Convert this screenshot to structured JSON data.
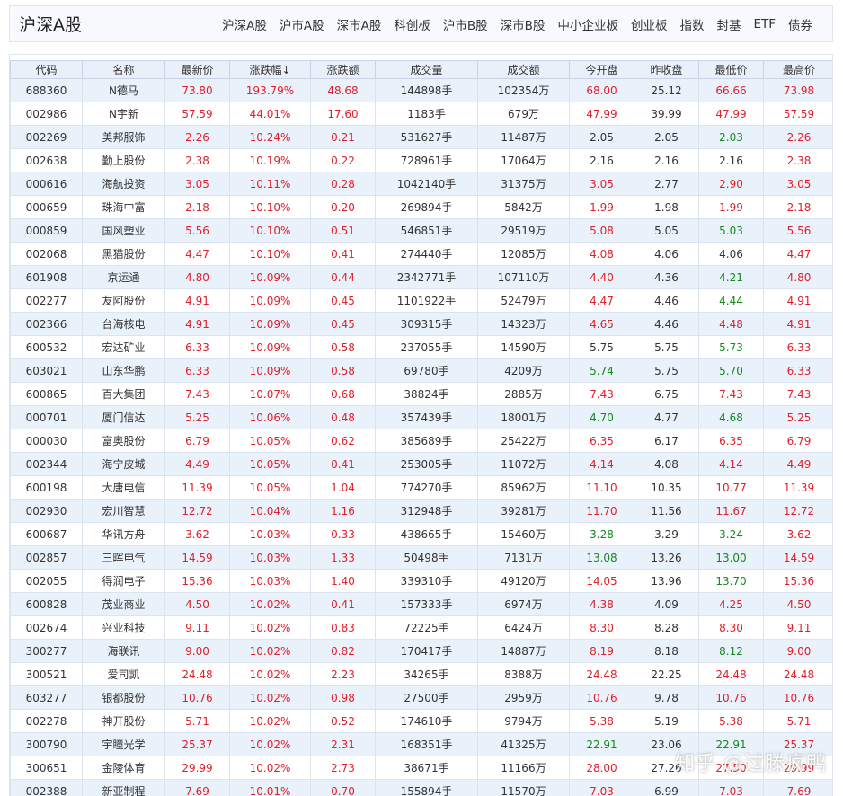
{
  "header": {
    "title": "沪深A股",
    "nav": [
      "沪深A股",
      "沪市A股",
      "深市A股",
      "科创板",
      "沪市B股",
      "深市B股",
      "中小企业板",
      "创业板",
      "指数",
      "封基",
      "ETF",
      "债券"
    ]
  },
  "table": {
    "columns": [
      "代码",
      "名称",
      "最新价",
      "涨跌幅↓",
      "涨跌额",
      "成交量",
      "成交额",
      "今开盘",
      "昨收盘",
      "最低价",
      "最高价"
    ],
    "rows": [
      [
        "688360",
        "N德马",
        "73.80",
        "193.79%",
        "48.68",
        "144898手",
        "102354万",
        "68.00",
        "25.12",
        "66.66",
        "73.98"
      ],
      [
        "002986",
        "N宇新",
        "57.59",
        "44.01%",
        "17.60",
        "1183手",
        "679万",
        "47.99",
        "39.99",
        "47.99",
        "57.59"
      ],
      [
        "002269",
        "美邦服饰",
        "2.26",
        "10.24%",
        "0.21",
        "531627手",
        "11487万",
        "2.05",
        "2.05",
        "2.03",
        "2.26"
      ],
      [
        "002638",
        "勤上股份",
        "2.38",
        "10.19%",
        "0.22",
        "728961手",
        "17064万",
        "2.16",
        "2.16",
        "2.16",
        "2.38"
      ],
      [
        "000616",
        "海航投资",
        "3.05",
        "10.11%",
        "0.28",
        "1042140手",
        "31375万",
        "3.05",
        "2.77",
        "2.90",
        "3.05"
      ],
      [
        "000659",
        "珠海中富",
        "2.18",
        "10.10%",
        "0.20",
        "269894手",
        "5842万",
        "1.99",
        "1.98",
        "1.99",
        "2.18"
      ],
      [
        "000859",
        "国风塑业",
        "5.56",
        "10.10%",
        "0.51",
        "546851手",
        "29519万",
        "5.08",
        "5.05",
        "5.03",
        "5.56"
      ],
      [
        "002068",
        "黑猫股份",
        "4.47",
        "10.10%",
        "0.41",
        "274440手",
        "12085万",
        "4.08",
        "4.06",
        "4.06",
        "4.47"
      ],
      [
        "601908",
        "京运通",
        "4.80",
        "10.09%",
        "0.44",
        "2342771手",
        "107110万",
        "4.40",
        "4.36",
        "4.21",
        "4.80"
      ],
      [
        "002277",
        "友阿股份",
        "4.91",
        "10.09%",
        "0.45",
        "1101922手",
        "52479万",
        "4.47",
        "4.46",
        "4.44",
        "4.91"
      ],
      [
        "002366",
        "台海核电",
        "4.91",
        "10.09%",
        "0.45",
        "309315手",
        "14323万",
        "4.65",
        "4.46",
        "4.48",
        "4.91"
      ],
      [
        "600532",
        "宏达矿业",
        "6.33",
        "10.09%",
        "0.58",
        "237055手",
        "14590万",
        "5.75",
        "5.75",
        "5.73",
        "6.33"
      ],
      [
        "603021",
        "山东华鹏",
        "6.33",
        "10.09%",
        "0.58",
        "69780手",
        "4209万",
        "5.74",
        "5.75",
        "5.70",
        "6.33"
      ],
      [
        "600865",
        "百大集团",
        "7.43",
        "10.07%",
        "0.68",
        "38824手",
        "2885万",
        "7.43",
        "6.75",
        "7.43",
        "7.43"
      ],
      [
        "000701",
        "厦门信达",
        "5.25",
        "10.06%",
        "0.48",
        "357439手",
        "18001万",
        "4.70",
        "4.77",
        "4.68",
        "5.25"
      ],
      [
        "000030",
        "富奥股份",
        "6.79",
        "10.05%",
        "0.62",
        "385689手",
        "25422万",
        "6.35",
        "6.17",
        "6.35",
        "6.79"
      ],
      [
        "002344",
        "海宁皮城",
        "4.49",
        "10.05%",
        "0.41",
        "253005手",
        "11072万",
        "4.14",
        "4.08",
        "4.14",
        "4.49"
      ],
      [
        "600198",
        "大唐电信",
        "11.39",
        "10.05%",
        "1.04",
        "774270手",
        "85962万",
        "11.10",
        "10.35",
        "10.77",
        "11.39"
      ],
      [
        "002930",
        "宏川智慧",
        "12.72",
        "10.04%",
        "1.16",
        "312948手",
        "39281万",
        "11.70",
        "11.56",
        "11.67",
        "12.72"
      ],
      [
        "600687",
        "华讯方舟",
        "3.62",
        "10.03%",
        "0.33",
        "438665手",
        "15460万",
        "3.28",
        "3.29",
        "3.24",
        "3.62"
      ],
      [
        "002857",
        "三晖电气",
        "14.59",
        "10.03%",
        "1.33",
        "50498手",
        "7131万",
        "13.08",
        "13.26",
        "13.00",
        "14.59"
      ],
      [
        "002055",
        "得润电子",
        "15.36",
        "10.03%",
        "1.40",
        "339310手",
        "49120万",
        "14.05",
        "13.96",
        "13.70",
        "15.36"
      ],
      [
        "600828",
        "茂业商业",
        "4.50",
        "10.02%",
        "0.41",
        "157333手",
        "6974万",
        "4.38",
        "4.09",
        "4.25",
        "4.50"
      ],
      [
        "002674",
        "兴业科技",
        "9.11",
        "10.02%",
        "0.83",
        "72225手",
        "6424万",
        "8.30",
        "8.28",
        "8.30",
        "9.11"
      ],
      [
        "300277",
        "海联讯",
        "9.00",
        "10.02%",
        "0.82",
        "170417手",
        "14887万",
        "8.19",
        "8.18",
        "8.12",
        "9.00"
      ],
      [
        "300521",
        "爱司凯",
        "24.48",
        "10.02%",
        "2.23",
        "34265手",
        "8388万",
        "24.48",
        "22.25",
        "24.48",
        "24.48"
      ],
      [
        "603277",
        "银都股份",
        "10.76",
        "10.02%",
        "0.98",
        "27500手",
        "2959万",
        "10.76",
        "9.78",
        "10.76",
        "10.76"
      ],
      [
        "002278",
        "神开股份",
        "5.71",
        "10.02%",
        "0.52",
        "174610手",
        "9794万",
        "5.38",
        "5.19",
        "5.38",
        "5.71"
      ],
      [
        "300790",
        "宇瞳光学",
        "25.37",
        "10.02%",
        "2.31",
        "168351手",
        "41325万",
        "22.91",
        "23.06",
        "22.91",
        "25.37"
      ],
      [
        "300651",
        "金陵体育",
        "29.99",
        "10.02%",
        "2.73",
        "38671手",
        "11166万",
        "28.00",
        "27.26",
        "27.50",
        "29.99"
      ],
      [
        "002388",
        "新亚制程",
        "7.69",
        "10.01%",
        "0.70",
        "155894手",
        "11570万",
        "7.03",
        "6.99",
        "7.03",
        "7.69"
      ]
    ]
  },
  "colors": {
    "up": "#e0202a",
    "down": "#138a1c",
    "header_bg": "#e9f0fa",
    "row_alt": "#e9f1fb"
  },
  "watermark": "知乎 @过滕疯鸭"
}
